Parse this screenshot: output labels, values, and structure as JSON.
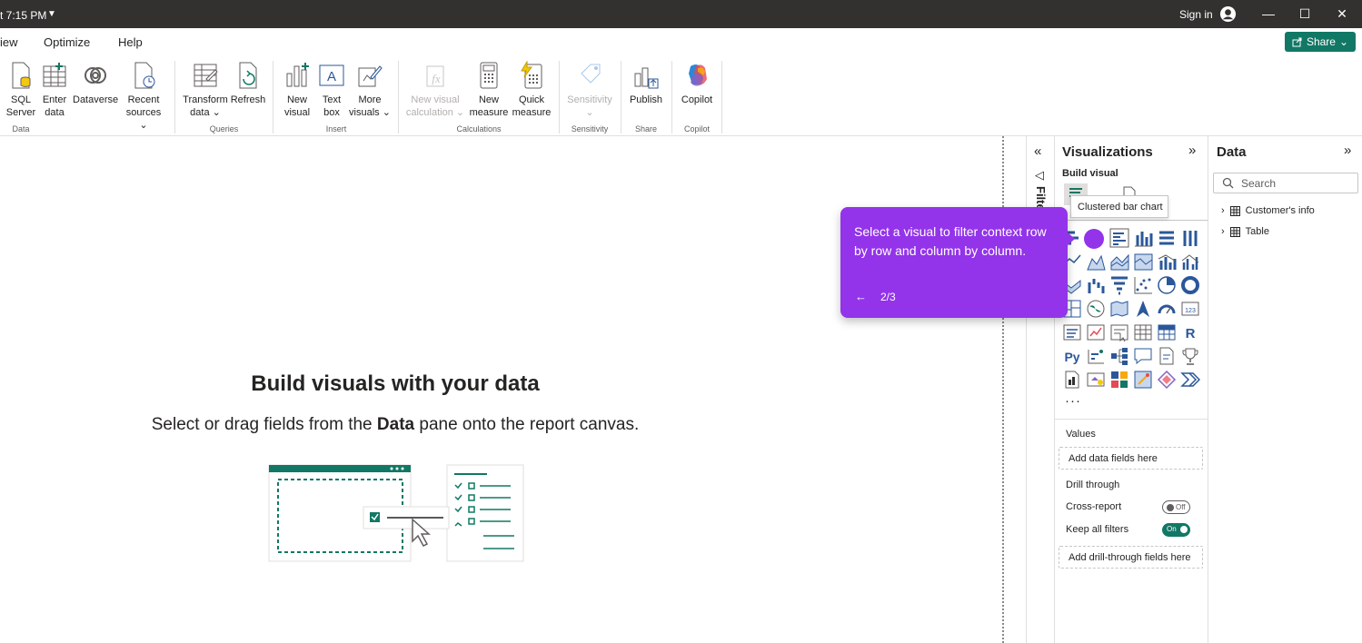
{
  "titlebar": {
    "time": "t 7:15 PM",
    "signin": "Sign in",
    "minimize": "—",
    "maximize": "☐",
    "close": "✕"
  },
  "menu": [
    "iew",
    "Optimize",
    "Help"
  ],
  "share": {
    "label": "Share"
  },
  "ribbon": {
    "buttons": [
      {
        "l1": "SQL",
        "l2": "Server"
      },
      {
        "l1": "Enter",
        "l2": "data"
      },
      {
        "l1": "Dataverse",
        "l2": ""
      },
      {
        "l1": "Recent",
        "l2": "sources ⌄"
      },
      {
        "l1": "Transform",
        "l2": "data ⌄"
      },
      {
        "l1": "Refresh",
        "l2": ""
      },
      {
        "l1": "New",
        "l2": "visual"
      },
      {
        "l1": "Text",
        "l2": "box"
      },
      {
        "l1": "More",
        "l2": "visuals ⌄"
      },
      {
        "l1": "New visual",
        "l2": "calculation ⌄"
      },
      {
        "l1": "New",
        "l2": "measure"
      },
      {
        "l1": "Quick",
        "l2": "measure"
      },
      {
        "l1": "Sensitivity",
        "l2": "⌄"
      },
      {
        "l1": "Publish",
        "l2": ""
      },
      {
        "l1": "Copilot",
        "l2": ""
      }
    ],
    "groups": [
      "Data",
      "Queries",
      "Insert",
      "Calculations",
      "Sensitivity",
      "Share",
      "Copilot"
    ]
  },
  "canvas": {
    "title": "Build visuals with your data",
    "sub_pre": "Select or drag fields from the ",
    "sub_bold": "Data",
    "sub_post": " pane onto the report canvas."
  },
  "filters": {
    "label": "Filters"
  },
  "viz": {
    "title": "Visualizations",
    "build": "Build visual",
    "values_label": "Values",
    "values_well": "Add data fields here",
    "drill_label": "Drill through",
    "cross_report": "Cross-report",
    "cross_state": "Off",
    "keep_filters": "Keep all filters",
    "keep_state": "On",
    "drill_well": "Add drill-through fields here",
    "more": "···",
    "python": "Py",
    "r": "R"
  },
  "data": {
    "title": "Data",
    "search_placeholder": "Search",
    "tables": [
      "Customer's info",
      "Table"
    ]
  },
  "tooltip": "Clustered bar chart",
  "coach": {
    "text": "Select a visual to filter context row by row and column by column.",
    "back": "←",
    "step": "2/3"
  },
  "colors": {
    "accent": "#117865",
    "coach": "#9333ea",
    "visual_blue": "#2b579a"
  }
}
